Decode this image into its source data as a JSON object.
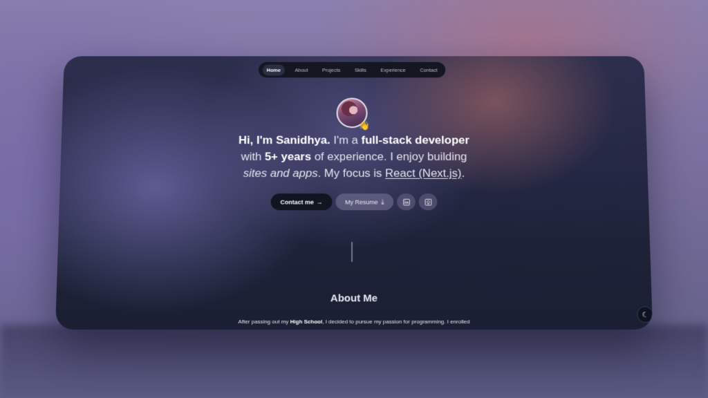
{
  "nav": {
    "items": [
      {
        "label": "Home",
        "active": true
      },
      {
        "label": "About"
      },
      {
        "label": "Projects"
      },
      {
        "label": "Skills"
      },
      {
        "label": "Experience"
      },
      {
        "label": "Contact"
      }
    ]
  },
  "avatar": {
    "badge_emoji": "👋"
  },
  "hero": {
    "greeting_bold": "Hi, I'm Sanidhya.",
    "intro": " I'm a ",
    "role_bold": "full-stack developer",
    "with": "with ",
    "years_bold": "5+ years",
    "experience": " of experience. I enjoy building",
    "sites_italic": "sites and apps",
    "focus": ". My focus is ",
    "tech_underline": "React (Next.js)",
    "end": "."
  },
  "actions": {
    "contact_label": "Contact me",
    "contact_arrow": "→",
    "resume_label": "My Resume",
    "resume_icon": "⤓",
    "linkedin_icon": "linkedin-icon",
    "github_icon": "github-icon"
  },
  "about": {
    "title": "About Me",
    "text_start": "After passing out my ",
    "text_bold": "High School",
    "text_end": ", I decided to pursue my passion for programming. I enrolled"
  },
  "theme": {
    "icon": "moon-icon",
    "glyph": "☾"
  }
}
